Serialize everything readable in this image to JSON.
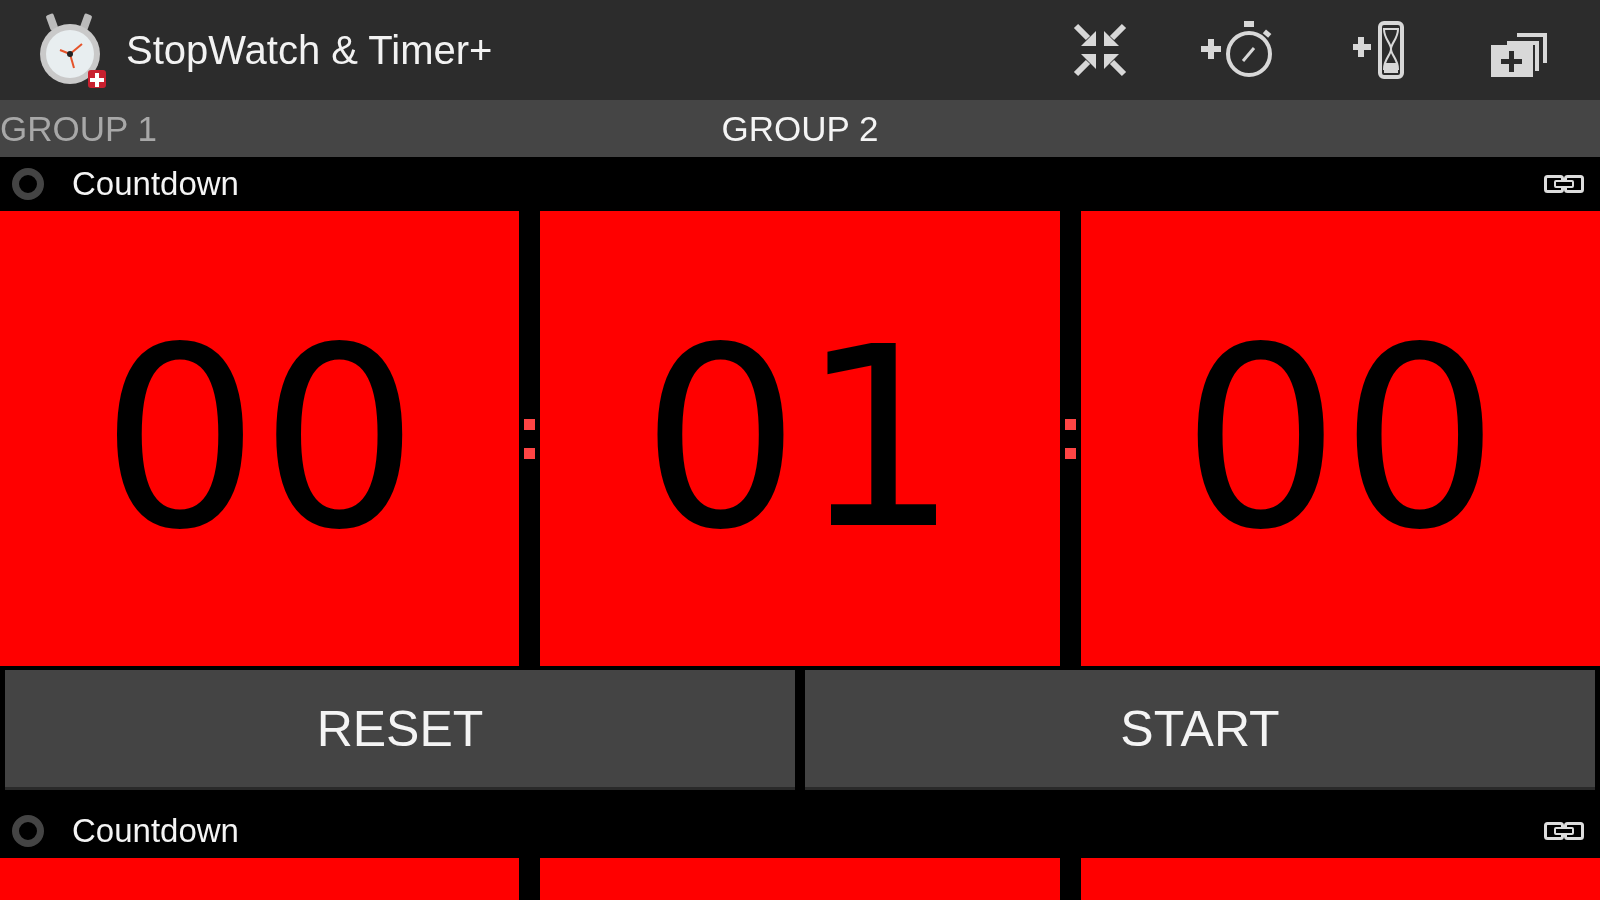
{
  "app_bar": {
    "title": "StopWatch & Timer+"
  },
  "group_tabs": [
    {
      "label": "GROUP 1",
      "selected": false
    },
    {
      "label": "GROUP 2",
      "selected": true
    }
  ],
  "timers": [
    {
      "name": "Countdown",
      "selected": false,
      "segments": [
        "00",
        "01",
        "00"
      ],
      "buttons": [
        "RESET",
        "START"
      ]
    },
    {
      "name": "Countdown",
      "selected": false
    }
  ]
}
